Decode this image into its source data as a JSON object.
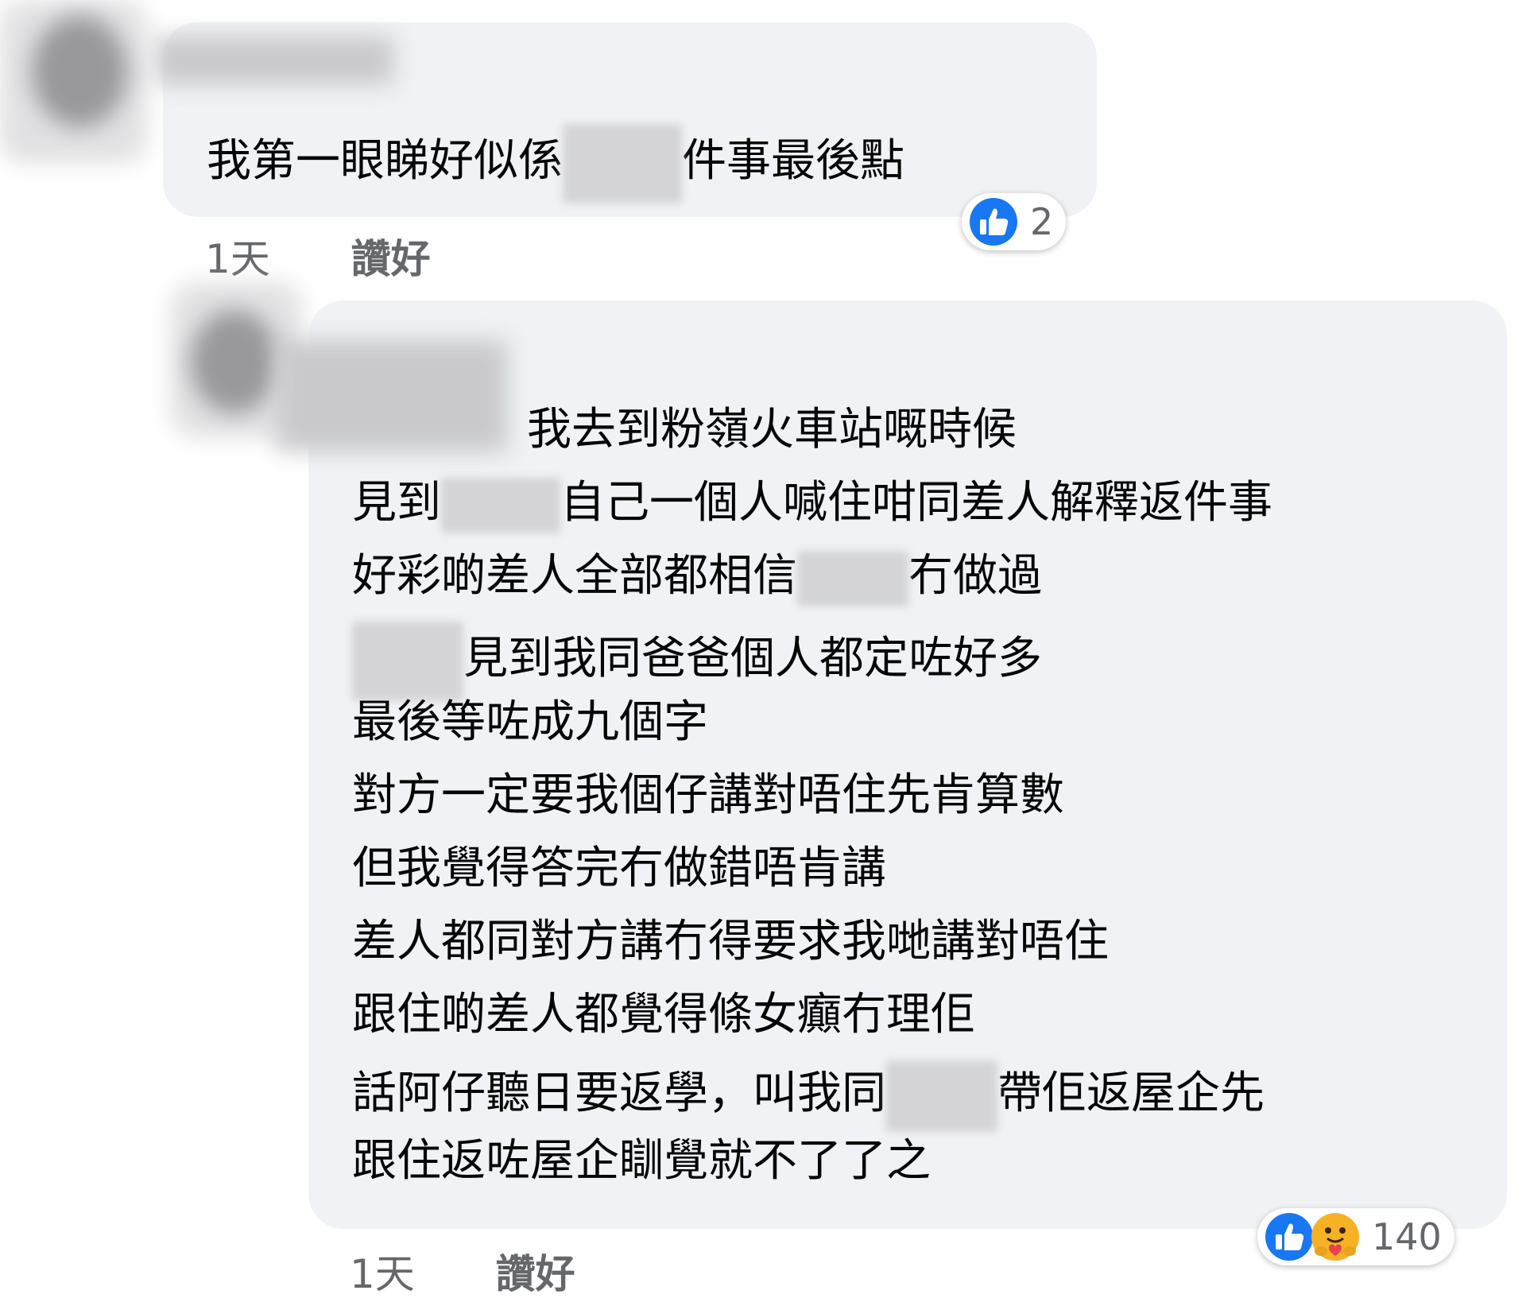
{
  "comments": [
    {
      "lines": [
        [
          "我第一眼睇好似係",
          "件事最後點"
        ]
      ],
      "reaction_icons": [
        "like-icon"
      ],
      "reaction_count": "2",
      "time": "1天",
      "like_label": "讚好"
    },
    {
      "lines": [
        [
          "我去到粉嶺火車站嘅時候"
        ],
        [
          "見到",
          "自己一個人喊住咁同差人解釋返件事"
        ],
        [
          "好彩啲差人全部都相信",
          "冇做過"
        ],
        [
          "見到我同爸爸個人都定咗好多"
        ],
        [
          "最後等咗成九個字"
        ],
        [
          "對方一定要我個仔講對唔住先肯算數"
        ],
        [
          "但我覺得答完冇做錯唔肯講"
        ],
        [
          "差人都同對方講冇得要求我哋講對唔住"
        ],
        [
          "跟住啲差人都覺得條女癲冇理佢"
        ],
        [
          "話阿仔聽日要返學，叫我同",
          "帶佢返屋企先"
        ],
        [
          "跟住返咗屋企瞓覺就不了了之"
        ]
      ],
      "reaction_icons": [
        "like-icon",
        "care-icon"
      ],
      "reaction_count": "140",
      "time": "1天",
      "like_label": "讚好"
    }
  ],
  "colors": {
    "bubble": "#f0f2f5",
    "like_blue": "#1877f2",
    "meta_gray": "#65676b"
  }
}
